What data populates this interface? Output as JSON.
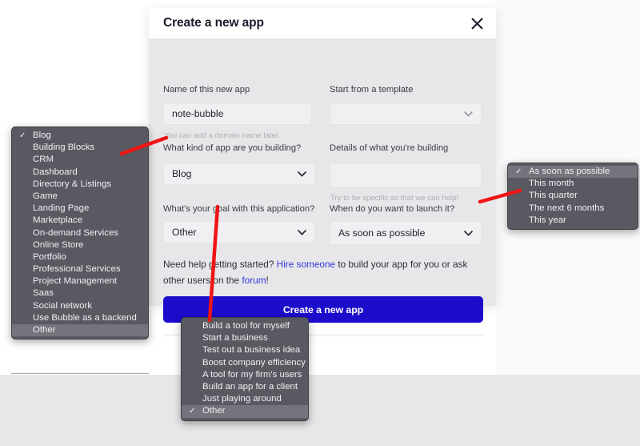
{
  "modal": {
    "title": "Create a new app",
    "close_icon": "close-icon",
    "fields": {
      "name": {
        "label": "Name of this new app",
        "value": "note-bubble",
        "placeholder": "",
        "hint": "You can add a domain name later."
      },
      "template": {
        "label": "Start from a template",
        "value": "",
        "chevron_icon": "chevron-down-icon"
      },
      "kind": {
        "label": "What kind of app are you building?",
        "value": "Blog",
        "chevron_icon": "chevron-down-icon"
      },
      "details": {
        "label": "Details of what you're building",
        "value": "",
        "placeholder": "",
        "hint": "Try to be specific so that we can help!"
      },
      "goal": {
        "label": "What's your goal with this application?",
        "value": "Other",
        "chevron_icon": "chevron-down-icon"
      },
      "launch": {
        "label": "When do you want to launch it?",
        "value": "As soon as possible",
        "chevron_icon": "chevron-down-icon"
      }
    },
    "help": {
      "part1": "Need help getting started? ",
      "link1": "Hire someone",
      "part2": " to build your app for you or ask other users on the ",
      "link2": "forum",
      "part3": "!"
    },
    "submit_label": "Create a new app"
  },
  "popups": {
    "kind": {
      "name": "app-kind-dropdown",
      "checked": "Blog",
      "highlighted": "Other",
      "items": [
        "Blog",
        "Building Blocks",
        "CRM",
        "Dashboard",
        "Directory & Listings",
        "Game",
        "Landing Page",
        "Marketplace",
        "On-demand Services",
        "Online Store",
        "Portfolio",
        "Professional Services",
        "Project Management",
        "Saas",
        "Social network",
        "Use Bubble as a backend",
        "Other"
      ]
    },
    "launch": {
      "name": "launch-timing-dropdown",
      "checked": "As soon as possible",
      "highlighted": "As soon as possible",
      "items": [
        "As soon as possible",
        "This month",
        "This quarter",
        "The next 6 months",
        "This year"
      ]
    },
    "goal": {
      "name": "goal-dropdown",
      "checked": "Other",
      "highlighted": "Other",
      "items": [
        "Build a tool for myself",
        "Start a business",
        "Test out a business idea",
        "Boost company efficiency",
        "A tool for my firm's users",
        "Build an app for a client",
        "Just playing around",
        "Other"
      ]
    }
  },
  "colors": {
    "accent": "#1c0ccc",
    "link": "#3636dd",
    "modal_bg": "#e7e7e9",
    "field_bg": "#eff0f2",
    "popup_bg": "#595962",
    "popup_highlight": "#74747d",
    "annotation": "#f01414"
  },
  "checkmark": "✓"
}
